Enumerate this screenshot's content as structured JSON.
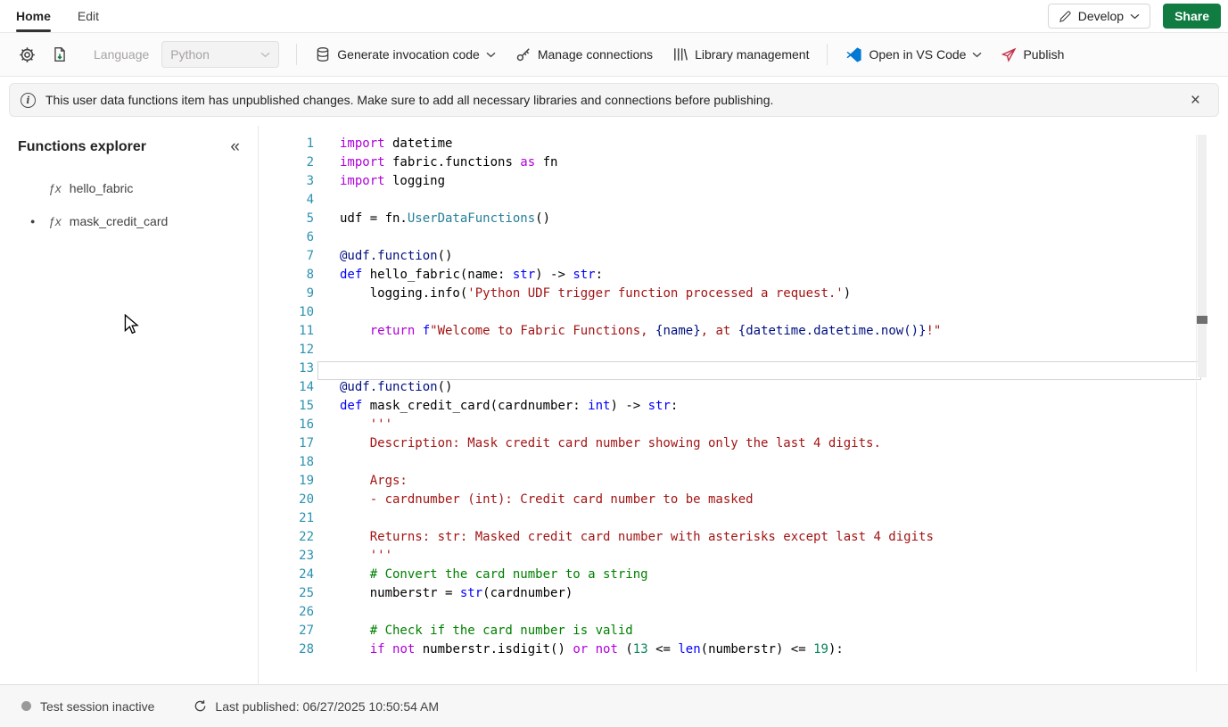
{
  "colors": {
    "accent-green": "#107C41",
    "vscode-blue": "#0078D4",
    "publish-pink": "#C4314B",
    "tab-underline": "#333333",
    "linenum": "#2B91AF",
    "kw": "#AF00DB",
    "def": "#0000FF",
    "type": "#0000FF",
    "str": "#A31515",
    "com": "#008000",
    "num": "#098658",
    "cls": "#267F99",
    "interp": "#001080",
    "dec": "#001080"
  },
  "tabs": {
    "home": "Home",
    "edit": "Edit"
  },
  "header": {
    "develop_label": "Develop",
    "share_label": "Share"
  },
  "toolbar": {
    "language_label": "Language",
    "language_value": "Python",
    "generate_label": "Generate invocation code",
    "connections_label": "Manage connections",
    "library_label": "Library management",
    "vscode_label": "Open in VS Code",
    "publish_label": "Publish"
  },
  "banner": {
    "info_icon": "i",
    "text": "This user data functions item has unpublished changes. Make sure to add all necessary libraries and connections before publishing.",
    "close_icon": "×"
  },
  "explorer": {
    "title": "Functions explorer",
    "collapse_icon": "«",
    "fx_icon": "ƒx",
    "modified_dot": "●",
    "items": [
      {
        "label": "hello_fabric",
        "modified": false
      },
      {
        "label": "mask_credit_card",
        "modified": true
      }
    ]
  },
  "editor": {
    "active_line": 13,
    "lines": [
      "import datetime",
      "import fabric.functions as fn",
      "import logging",
      "",
      "udf = fn.UserDataFunctions()",
      "",
      "@udf.function()",
      "def hello_fabric(name: str) -> str:",
      "    logging.info('Python UDF trigger function processed a request.')",
      "",
      "    return f\"Welcome to Fabric Functions, {name}, at {datetime.datetime.now()}!\"",
      "",
      "",
      "@udf.function()",
      "def mask_credit_card(cardnumber: int) -> str:",
      "    '''",
      "    Description: Mask credit card number showing only the last 4 digits.",
      "",
      "    Args:",
      "    - cardnumber (int): Credit card number to be masked",
      "",
      "    Returns: str: Masked credit card number with asterisks except last 4 digits",
      "    '''",
      "    # Convert the card number to a string",
      "    numberstr = str(cardnumber)",
      "",
      "    # Check if the card number is valid",
      "    if not numberstr.isdigit() or not (13 <= len(numberstr) <= 19):"
    ]
  },
  "statusbar": {
    "session_status": "Test session inactive",
    "last_published": "Last published: 06/27/2025 10:50:54 AM"
  }
}
